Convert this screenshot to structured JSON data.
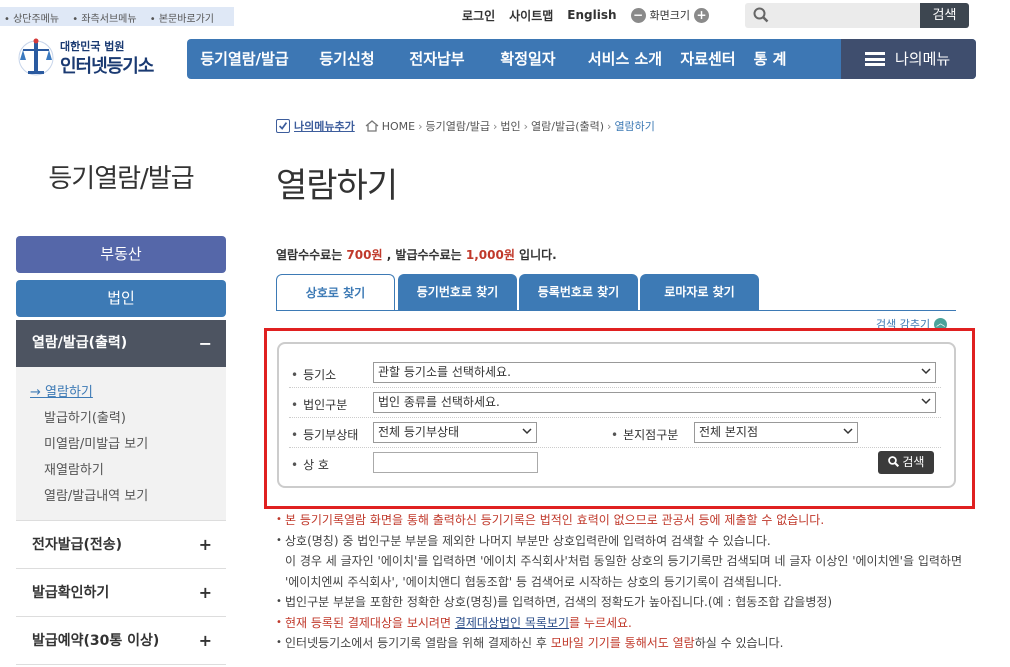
{
  "skip_links": [
    "상단주메뉴",
    "좌측서브메뉴",
    "본문바로가기"
  ],
  "util": {
    "login": "로그인",
    "sitemap": "사이트맵",
    "english": "English",
    "zoom": "화면크기"
  },
  "top_search": {
    "placeholder": "",
    "button": "검색"
  },
  "logo": {
    "sub": "대한민국 법원",
    "main": "인터넷등기소"
  },
  "gnb": [
    "등기열람/발급",
    "등기신청",
    "전자납부",
    "확정일자",
    "서비스 소개",
    "자료센터",
    "통 계"
  ],
  "my_menu": "나의메뉴",
  "breadcrumb": {
    "my": "나의메뉴추가",
    "items": [
      "HOME",
      "등기열람/발급",
      "법인",
      "열람/발급(출력)"
    ],
    "current": "열람하기"
  },
  "sidebar": {
    "title": "등기열람/발급",
    "btn_realestate": "부동산",
    "btn_corp": "법인",
    "section": "열람/발급(출력)",
    "section_toggle": "−",
    "sub_items": [
      "열람하기",
      "발급하기(출력)",
      "미열람/미발급 보기",
      "재열람하기",
      "열람/발급내역 보기"
    ],
    "rows": [
      "전자발급(전송)",
      "발급확인하기",
      "발급예약(30통 이상)"
    ],
    "row_toggle": "+"
  },
  "page_title": "열람하기",
  "fee": {
    "p1": "열람수수료는 ",
    "v1": "700원",
    "p2": " , 발급수수료는 ",
    "v2": "1,000원",
    "p3": " 입니다."
  },
  "tabs": [
    "상호로 찾기",
    "등기번호로 찾기",
    "등록번호로 찾기",
    "로마자로 찾기"
  ],
  "fold_label": "검색 감추기",
  "form": {
    "registry_label": "등기소",
    "registry_value": "관할 등기소를 선택하세요.",
    "corp_type_label": "법인구분",
    "corp_type_value": "법인 종류를 선택하세요.",
    "status_label": "등기부상태",
    "status_value": "전체 등기부상태",
    "branch_label": "본지점구분",
    "branch_value": "전체 본지점",
    "name_label": "상 호",
    "name_value": "",
    "search_button": "검색"
  },
  "notes": {
    "n1": "본 등기기록열람 화면을 통해 출력하신 등기기록은 법적인 효력이 없으므로 관공서 등에 제출할 수 없습니다.",
    "n2": "상호(명칭) 중 법인구분 부분을 제외한 나머지 부분만 상호입력란에 입력하여 검색할 수 있습니다.",
    "n2b": "이 경우 세 글자인 '에이치'를 입력하면 '에이치 주식회사'처럼 동일한 상호의 등기기록만 검색되며 네 글자 이상인 '에이치엔'을 입력하면",
    "n2c": "'에이치엔씨 주식회사', '에이치앤디 협동조합' 등 검색어로 시작하는 상호의 등기기록이 검색됩니다.",
    "n3": "법인구분 부분을 포함한 정확한 상호(명칭)를 입력하면, 검색의 정확도가 높아집니다.(예 : 협동조합 갑을병정)",
    "n4a": "현재 등록된 결제대상을 보시려면 ",
    "n4b": "결제대상법인 목록보기",
    "n4c": "를 누르세요.",
    "n5a": "인터넷등기소에서 등기기록 열람을 위해 결제하신 후 ",
    "n5b": "모바일 기기를 통해서도 열람",
    "n5c": "하실 수 있습니다."
  },
  "colors": {
    "gnb": "#3d77b4",
    "accent_red": "#c0392b",
    "tab": "#3d7ab5",
    "highlight_box": "#e02020"
  }
}
